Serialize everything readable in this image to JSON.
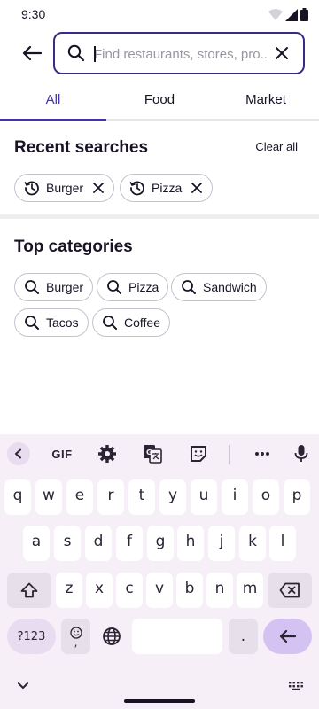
{
  "status": {
    "time": "9:30"
  },
  "search": {
    "placeholder": "Find restaurants, stores, pro..."
  },
  "tabs": [
    {
      "label": "All",
      "active": true
    },
    {
      "label": "Food",
      "active": false
    },
    {
      "label": "Market",
      "active": false
    }
  ],
  "recent": {
    "title": "Recent searches",
    "clear_label": "Clear all",
    "items": [
      "Burger",
      "Pizza"
    ]
  },
  "categories": {
    "title": "Top categories",
    "items": [
      "Burger",
      "Pizza",
      "Sandwich",
      "Tacos",
      "Coffee"
    ]
  },
  "keyboard": {
    "gif_label": "GIF",
    "row1": [
      "q",
      "w",
      "e",
      "r",
      "t",
      "y",
      "u",
      "i",
      "o",
      "p"
    ],
    "row2": [
      "a",
      "s",
      "d",
      "f",
      "g",
      "h",
      "j",
      "k",
      "l"
    ],
    "row3": [
      "z",
      "x",
      "c",
      "v",
      "b",
      "n",
      "m"
    ],
    "sym_label": "?123",
    "emoji_sub": ",",
    "period": "."
  },
  "colors": {
    "accent": "#4a2fb0",
    "border_focus": "#3a2a86",
    "enter_key": "#d4c2f3"
  }
}
